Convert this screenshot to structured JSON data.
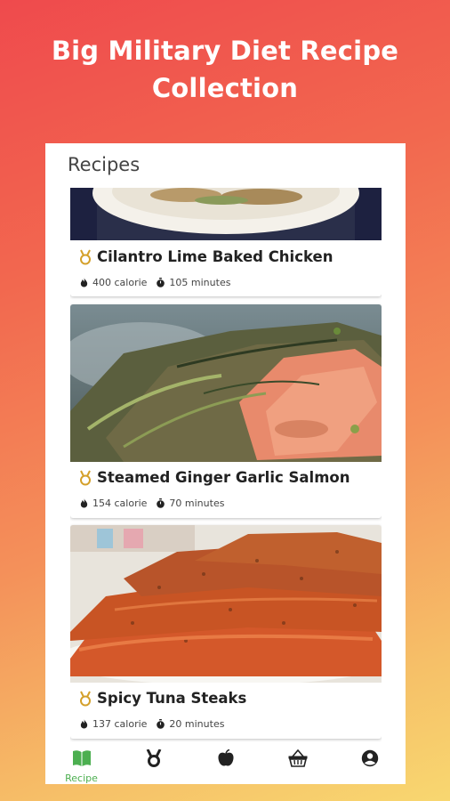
{
  "headline": {
    "line1": "Big Military Diet Recipe",
    "line2": "Collection"
  },
  "appbar": {
    "title": "Recipes"
  },
  "recipes": [
    {
      "name": "Cilantro Lime Baked Chicken",
      "calories": "400 calorie",
      "time": "105 minutes"
    },
    {
      "name": "Steamed Ginger Garlic Salmon",
      "calories": "154 calorie",
      "time": "70 minutes"
    },
    {
      "name": "Spicy Tuna Steaks",
      "calories": "137 calorie",
      "time": "20 minutes"
    }
  ],
  "nav": {
    "items": [
      {
        "icon": "book-icon",
        "label": "Recipe",
        "active": true
      },
      {
        "icon": "medal-icon",
        "label": ""
      },
      {
        "icon": "apple-icon",
        "label": ""
      },
      {
        "icon": "basket-icon",
        "label": ""
      },
      {
        "icon": "account-icon",
        "label": ""
      }
    ]
  },
  "colors": {
    "accent": "#4caf50",
    "medal": "#d4a02a",
    "title": "#222222"
  }
}
